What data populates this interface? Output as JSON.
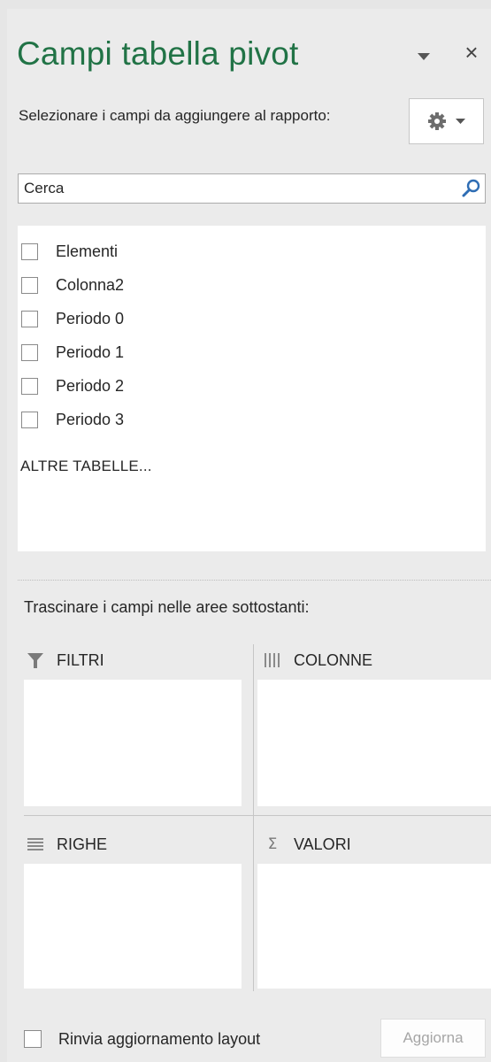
{
  "pane": {
    "title": "Campi tabella pivot",
    "close_symbol": "×",
    "menu_icon": "chevron-down-icon",
    "instruction": "Selezionare i campi da aggiungere al rapporto:",
    "tools_icon": "gear-icon"
  },
  "search": {
    "placeholder": "Cerca",
    "icon": "search-icon"
  },
  "fields": [
    {
      "label": "Elementi",
      "checked": false
    },
    {
      "label": "Colonna2",
      "checked": false
    },
    {
      "label": "Periodo 0",
      "checked": false
    },
    {
      "label": "Periodo 1",
      "checked": false
    },
    {
      "label": "Periodo 2",
      "checked": false
    },
    {
      "label": "Periodo 3",
      "checked": false
    }
  ],
  "more_tables": "ALTRE TABELLE...",
  "areas": {
    "instruction": "Trascinare i campi nelle aree sottostanti:",
    "filters": {
      "label": "FILTRI",
      "icon": "filter-icon"
    },
    "columns": {
      "label": "COLONNE",
      "icon": "columns-icon"
    },
    "rows": {
      "label": "RIGHE",
      "icon": "rows-icon"
    },
    "values": {
      "label": "VALORI",
      "icon": "sigma-icon",
      "symbol": "Σ"
    }
  },
  "footer": {
    "defer_label": "Rinvia aggiornamento layout",
    "defer_checked": false,
    "update_label": "Aggiorna"
  },
  "colors": {
    "title": "#217346",
    "pane_background": "#ebebeb",
    "disabled_text": "#a6a6a6"
  }
}
